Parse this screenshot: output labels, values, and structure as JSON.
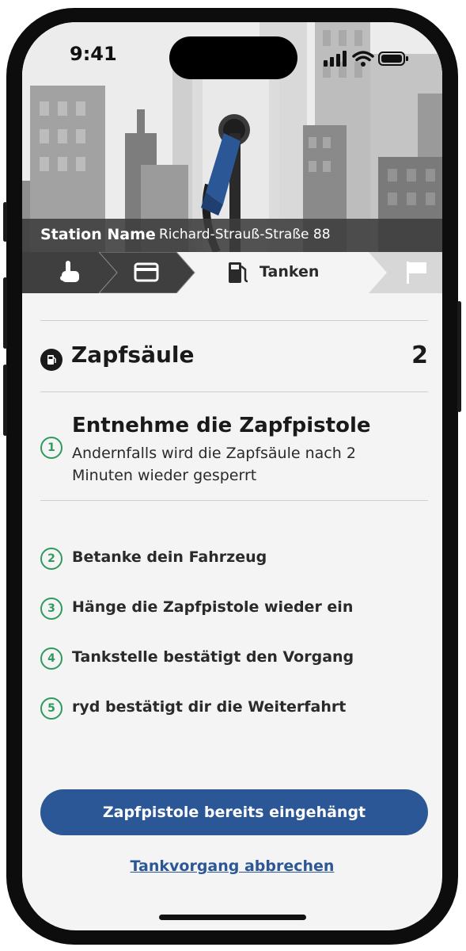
{
  "status_bar": {
    "time": "9:41"
  },
  "station": {
    "label": "Station Name",
    "address": "Richard-Strauß-Straße 88"
  },
  "progress": {
    "steps": [
      {
        "icon": "hand-tap-icon",
        "state": "done"
      },
      {
        "icon": "credit-card-icon",
        "state": "done"
      },
      {
        "icon": "fuel-pump-icon",
        "state": "active",
        "label": "Tanken"
      },
      {
        "icon": "flag-icon",
        "state": "upcoming"
      }
    ]
  },
  "pump": {
    "title": "Zapfsäule",
    "number": "2"
  },
  "current_step": {
    "number": "1",
    "title": "Entnehme die Zapfpistole",
    "subtitle": "Andernfalls wird die Zapfsäule nach 2 Minuten wieder gesperrt"
  },
  "steps": [
    {
      "number": "2",
      "label": "Betanke dein Fahrzeug"
    },
    {
      "number": "3",
      "label": "Hänge die Zapfpistole wieder ein"
    },
    {
      "number": "4",
      "label": "Tankstelle bestätigt den Vorgang"
    },
    {
      "number": "5",
      "label": "ryd bestätigt dir die Weiterfahrt"
    }
  ],
  "actions": {
    "primary": "Zapfpistole bereits eingehängt",
    "cancel": "Tankvorgang abbrechen"
  },
  "colors": {
    "accent": "#2c5797",
    "step_green": "#2f9a5e",
    "station_bar": "#3c3c3c"
  }
}
